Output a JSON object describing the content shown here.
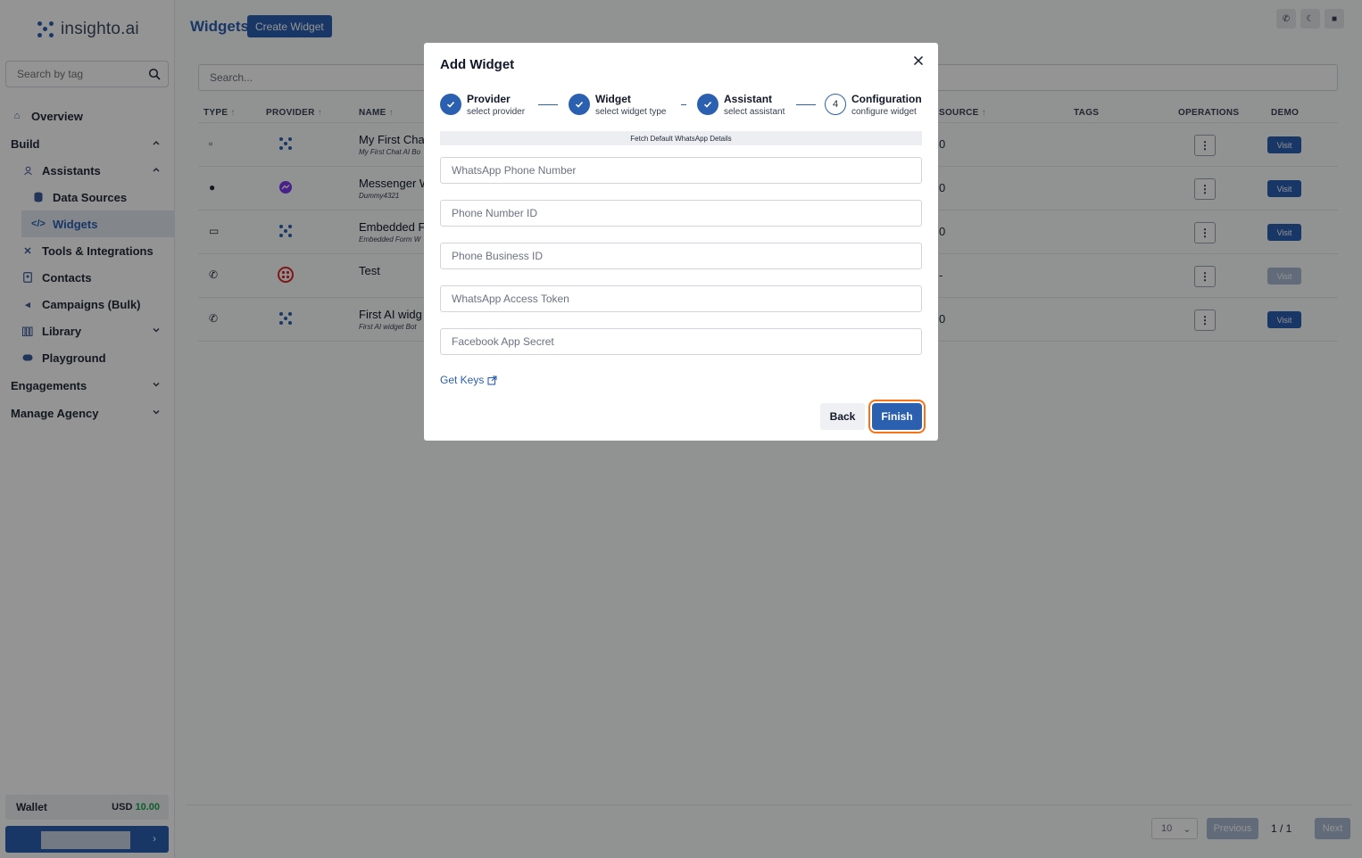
{
  "app": {
    "brand": "insighto.ai",
    "search_placeholder": "Search by tag",
    "page_title": "Widgets",
    "create_label": "Create Widget",
    "table_search_placeholder": "Search...",
    "nav": {
      "overview": "Overview",
      "build": "Build",
      "assistants": "Assistants",
      "data_sources": "Data Sources",
      "widgets": "Widgets",
      "tools": "Tools & Integrations",
      "contacts": "Contacts",
      "campaigns": "Campaigns (Bulk)",
      "library": "Library",
      "playground": "Playground",
      "engagements": "Engagements",
      "manage_agency": "Manage Agency"
    },
    "wallet": {
      "label": "Wallet",
      "currency": "USD",
      "amount": "10.00"
    },
    "table": {
      "headers": {
        "type": "TYPE",
        "provider": "PROVIDER",
        "name": "NAME",
        "source": "SOURCE",
        "tags": "TAGS",
        "operations": "OPERATIONS",
        "demo": "DEMO"
      },
      "rows": [
        {
          "name": "My First Cha",
          "sub": "My First Chat AI Bo",
          "source": "0",
          "visit": "Visit"
        },
        {
          "name": "Messenger W",
          "sub": "Dummy4321",
          "source": "0",
          "visit": "Visit"
        },
        {
          "name": "Embedded F",
          "sub": "Embedded Form W",
          "source": "0",
          "visit": "Visit"
        },
        {
          "name": "Test",
          "sub": "",
          "source": "-",
          "visit": "Visit"
        },
        {
          "name": "First AI widg",
          "sub": "First AI widget Bot",
          "source": "0",
          "visit": "Visit"
        }
      ]
    },
    "pagination": {
      "page_size": "10",
      "previous": "Previous",
      "info": "1 / 1",
      "next": "Next"
    }
  },
  "modal": {
    "title": "Add Widget",
    "steps": [
      {
        "title": "Provider",
        "subtitle": "select provider"
      },
      {
        "title": "Widget",
        "subtitle": "select widget type"
      },
      {
        "title": "Assistant",
        "subtitle": "select assistant"
      },
      {
        "number": "4",
        "title": "Configuration",
        "subtitle": "configure widget"
      }
    ],
    "fetch_label": "Fetch Default WhatsApp Details",
    "fields": {
      "wa_phone": "WhatsApp Phone Number",
      "phone_id": "Phone Number ID",
      "business_id": "Phone Business ID",
      "access_token": "WhatsApp Access Token",
      "app_secret": "Facebook App Secret"
    },
    "get_keys": "Get Keys",
    "back_label": "Back",
    "finish_label": "Finish"
  },
  "colors": {
    "primary": "#2b5fb0",
    "focus_ring": "#f97316",
    "wallet_amount": "#16a34a"
  }
}
